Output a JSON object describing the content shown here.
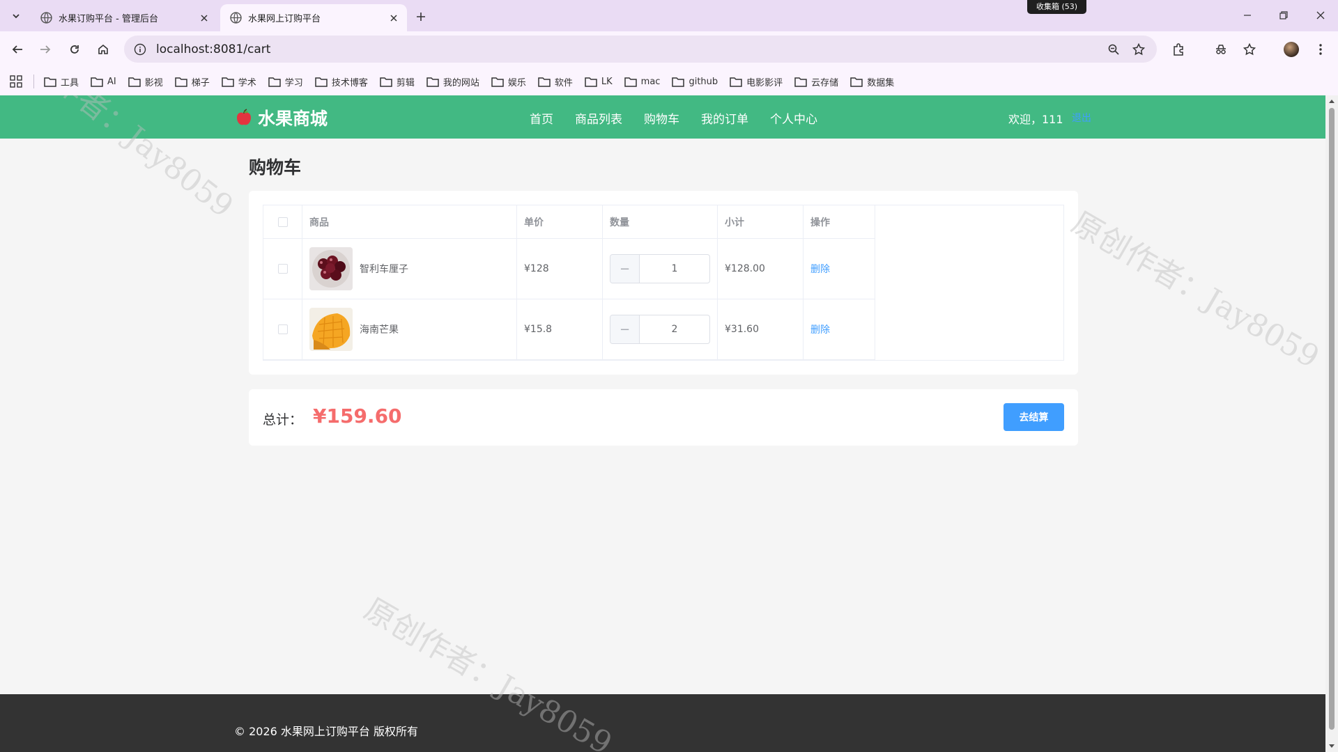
{
  "browser": {
    "tabs": [
      {
        "title": "水果订购平台 - 管理后台",
        "active": false
      },
      {
        "title": "水果网上订购平台",
        "active": true
      }
    ],
    "badge": "收集箱 (53)",
    "url": "localhost:8081/cart",
    "bookmarks": [
      "工具",
      "AI",
      "影视",
      "梯子",
      "学术",
      "学习",
      "技术博客",
      "剪辑",
      "我的网站",
      "娱乐",
      "软件",
      "LK",
      "mac",
      "github",
      "电影影评",
      "云存储",
      "数据集"
    ]
  },
  "site": {
    "logo": "水果商城",
    "nav": [
      "首页",
      "商品列表",
      "购物车",
      "我的订单",
      "个人中心"
    ],
    "welcome": "欢迎，111",
    "logout": "退出"
  },
  "page": {
    "title": "购物车",
    "columns": {
      "product": "商品",
      "price": "单价",
      "qty": "数量",
      "subtotal": "小计",
      "action": "操作"
    },
    "items": [
      {
        "name": "智利车厘子",
        "price": "¥128",
        "qty": "1",
        "subtotal": "¥128.00",
        "action": "删除",
        "stepper_minus": "−"
      },
      {
        "name": "海南芒果",
        "price": "¥15.8",
        "qty": "2",
        "subtotal": "¥31.60",
        "action": "删除",
        "stepper_minus": "−"
      }
    ],
    "total_label": "总计：",
    "total_value": "¥159.60",
    "checkout": "去结算"
  },
  "footer": "© 2026 水果网上订购平台 版权所有",
  "watermark": "原创作者：Jay8059",
  "colors": {
    "header": "#42b983",
    "link": "#409eff",
    "price": "#f56c6c",
    "footer": "#333333"
  }
}
